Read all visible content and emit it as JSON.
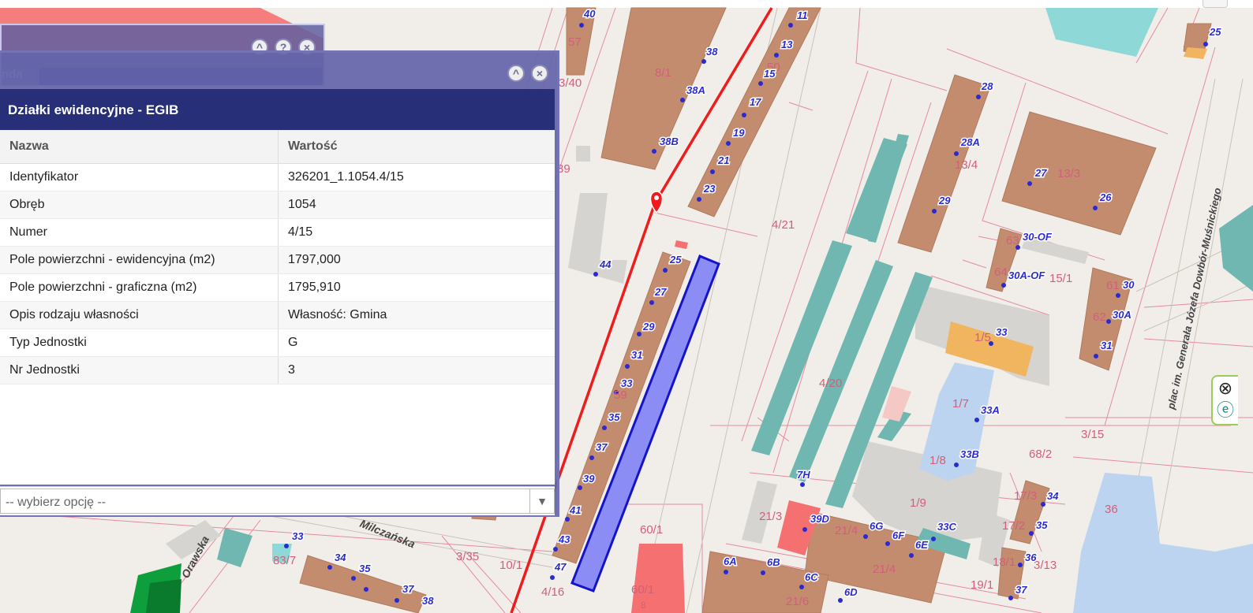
{
  "dialog": {
    "title": "Działki ewidencyjne - EGIB",
    "back_tab_label": "nda",
    "columns": [
      "Nazwa",
      "Wartość"
    ],
    "rows": [
      {
        "name": "Identyfikator",
        "value": "326201_1.1054.4/15"
      },
      {
        "name": "Obręb",
        "value": "1054"
      },
      {
        "name": "Numer",
        "value": "4/15"
      },
      {
        "name": "Pole powierzchni - ewidencyjna (m2)",
        "value": "1797,000"
      },
      {
        "name": "Pole powierzchni - graficzna (m2)",
        "value": "1795,910"
      },
      {
        "name": "Opis rodzaju własności",
        "value": "Własność: Gmina"
      },
      {
        "name": "Typ Jednostki",
        "value": "G"
      },
      {
        "name": "Nr Jednostki",
        "value": "3"
      }
    ],
    "select_placeholder": "-- wybierz opcję --",
    "help_glyph": "?",
    "collapse_glyph": "^",
    "close_glyph": "×"
  },
  "map": {
    "streets": [
      "Milczańska",
      "Orawska",
      "plac im. Generała Józefa Dowbór-Muśnickiego"
    ],
    "parcel_labels": [
      "57",
      "3/40",
      "8/1",
      "39",
      "4/21",
      "13/4",
      "13/3",
      "63",
      "64",
      "15/1",
      "61",
      "62",
      "1/5",
      "4/20",
      "1/7",
      "1/8",
      "1/9",
      "68/2",
      "3/15",
      "17/3",
      "17/2",
      "18/1",
      "3/13",
      "19/1",
      "36",
      "21/3",
      "21/4",
      "21/4",
      "21/6",
      "60/1",
      "60/1",
      "8",
      "3/35",
      "10/1",
      "4/16",
      "83/7",
      "59",
      "50"
    ],
    "address_labels": [
      "40",
      "38",
      "38A",
      "38B",
      "11",
      "13",
      "15",
      "17",
      "19",
      "21",
      "23",
      "25",
      "28",
      "28A",
      "29",
      "27",
      "26",
      "30-OF",
      "30A-OF",
      "30",
      "30A",
      "31",
      "33",
      "33A",
      "33B",
      "25",
      "27",
      "29",
      "31",
      "33",
      "35",
      "37",
      "39",
      "41",
      "43",
      "47",
      "44",
      "7H",
      "39D",
      "6G",
      "6F",
      "6E",
      "33C",
      "34",
      "35",
      "36",
      "37",
      "6A",
      "6B",
      "6C",
      "6D",
      "33",
      "34",
      "35",
      "37",
      "38"
    ],
    "widget_close_glyph": "⊗",
    "widget_globe_glyph": "ⓔ"
  }
}
